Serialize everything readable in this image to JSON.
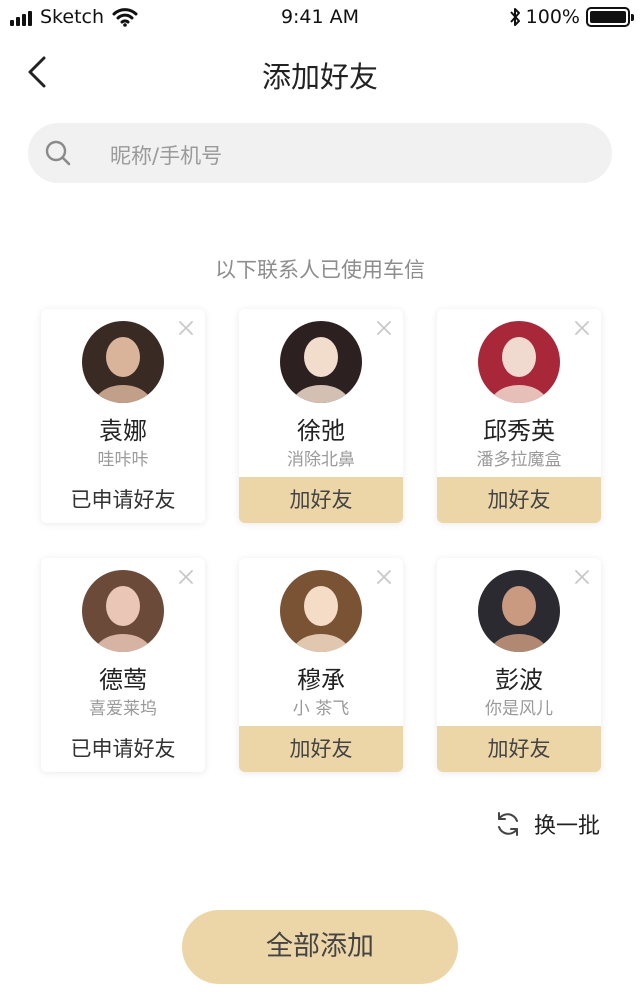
{
  "status_bar": {
    "carrier": "Sketch",
    "time": "9:41 AM",
    "battery": "100%",
    "battery_level": 1.0
  },
  "nav": {
    "title": "添加好友",
    "back_icon": "chevron-left-icon"
  },
  "search": {
    "placeholder": "昵称/手机号",
    "icon": "search-icon"
  },
  "hint": "以下联系人已使用车信",
  "contacts": [
    {
      "name": "袁娜",
      "subtitle": "哇咔咔",
      "action": "已申请好友",
      "state": "applied",
      "avatar_colors": [
        "#3a2a24",
        "#d9b49a"
      ]
    },
    {
      "name": "徐弛",
      "subtitle": "消除北鼻",
      "action": "加好友",
      "state": "add",
      "avatar_colors": [
        "#2c2120",
        "#f2dccc"
      ]
    },
    {
      "name": "邱秀英",
      "subtitle": "潘多拉魔盒",
      "action": "加好友",
      "state": "add",
      "avatar_colors": [
        "#a8283a",
        "#f0d9cf"
      ]
    },
    {
      "name": "德莺",
      "subtitle": "喜爱莱坞",
      "action": "已申请好友",
      "state": "applied",
      "avatar_colors": [
        "#6b4a3a",
        "#e9c6b5"
      ]
    },
    {
      "name": "穆承",
      "subtitle": "小 茶飞",
      "action": "加好友",
      "state": "add",
      "avatar_colors": [
        "#7a5234",
        "#f4dcc7"
      ]
    },
    {
      "name": "彭波",
      "subtitle": "你是风儿",
      "action": "加好友",
      "state": "add",
      "avatar_colors": [
        "#2a2a30",
        "#c99a7f"
      ]
    }
  ],
  "refresh": {
    "label": "换一批",
    "icon": "refresh-icon"
  },
  "add_all": {
    "label": "全部添加"
  },
  "colors": {
    "accent": "#ecd6a7",
    "search_bg": "#f1f1f1",
    "muted_text": "#9a9a9a"
  }
}
